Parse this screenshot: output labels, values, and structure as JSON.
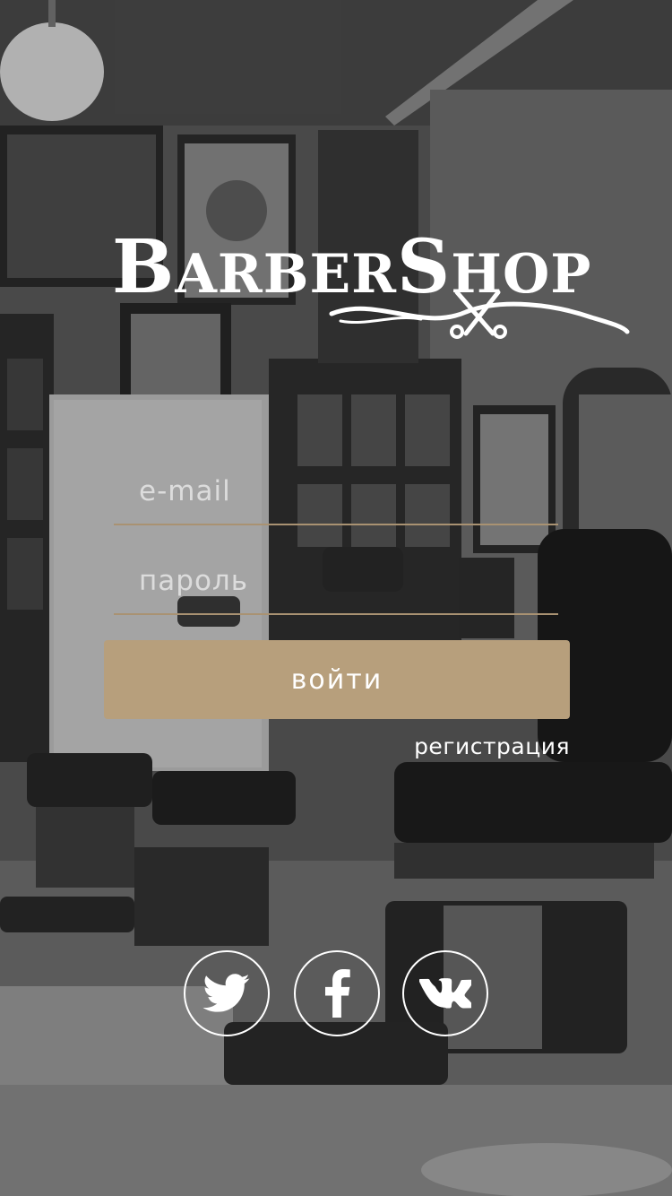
{
  "brand": {
    "logo_big_1": "B",
    "logo_small_1": "ARBER",
    "logo_big_2": "S",
    "logo_small_2": "HOP"
  },
  "login_form": {
    "email_placeholder": "e-mail",
    "password_placeholder": "пароль",
    "login_button_label": "войти",
    "register_link_label": "регистрация"
  },
  "social": [
    {
      "network": "twitter",
      "icon": "twitter-bird-icon"
    },
    {
      "network": "facebook",
      "icon": "facebook-f-icon"
    },
    {
      "network": "vk",
      "icon": "vk-icon"
    }
  ],
  "colors": {
    "accent": "#b79f7c",
    "field_underline": "#a99272",
    "text": "#ffffff"
  }
}
